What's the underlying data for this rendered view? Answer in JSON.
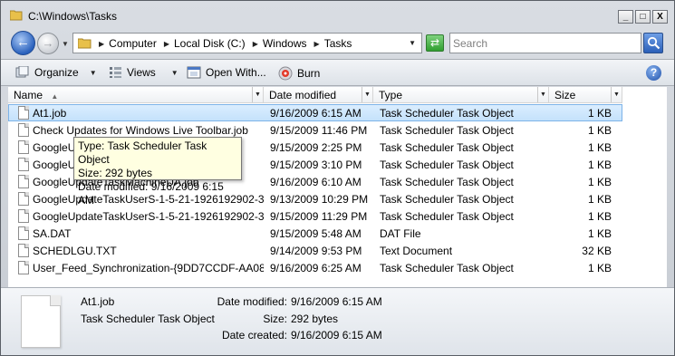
{
  "window": {
    "title": "C:\\Windows\\Tasks",
    "minimize": "_",
    "maximize": "□",
    "close": "X"
  },
  "address": {
    "crumbs": [
      "Computer",
      "Local Disk (C:)",
      "Windows",
      "Tasks"
    ],
    "search_placeholder": "Search"
  },
  "toolbar": {
    "organize": "Organize",
    "views": "Views",
    "open_with": "Open With...",
    "burn": "Burn",
    "help": "?"
  },
  "columns": {
    "name": "Name",
    "date": "Date modified",
    "type": "Type",
    "size": "Size"
  },
  "files": [
    {
      "name": "At1.job",
      "date": "9/16/2009 6:15 AM",
      "type": "Task Scheduler Task Object",
      "size": "1 KB"
    },
    {
      "name": "Check Updates for Windows Live Toolbar.job",
      "date": "9/15/2009 11:46 PM",
      "type": "Task Scheduler Task Object",
      "size": "1 KB"
    },
    {
      "name": "GoogleUpdateTaskMachineCore.job",
      "date": "9/15/2009 2:25 PM",
      "type": "Task Scheduler Task Object",
      "size": "1 KB"
    },
    {
      "name": "GoogleUpdateTaskMachineUA.job",
      "date": "9/15/2009 3:10 PM",
      "type": "Task Scheduler Task Object",
      "size": "1 KB"
    },
    {
      "name": "GoogleUpdateTaskMachineUA.job",
      "date": "9/16/2009 6:10 AM",
      "type": "Task Scheduler Task Object",
      "size": "1 KB"
    },
    {
      "name": "GoogleUpdateTaskUserS-1-5-21-1926192902-3...",
      "date": "9/13/2009 10:29 PM",
      "type": "Task Scheduler Task Object",
      "size": "1 KB"
    },
    {
      "name": "GoogleUpdateTaskUserS-1-5-21-1926192902-3...",
      "date": "9/15/2009 11:29 PM",
      "type": "Task Scheduler Task Object",
      "size": "1 KB"
    },
    {
      "name": "SA.DAT",
      "date": "9/15/2009 5:48 AM",
      "type": "DAT File",
      "size": "1 KB"
    },
    {
      "name": "SCHEDLGU.TXT",
      "date": "9/14/2009 9:53 PM",
      "type": "Text Document",
      "size": "32 KB"
    },
    {
      "name": "User_Feed_Synchronization-{9DD7CCDF-AA08...",
      "date": "9/16/2009 6:25 AM",
      "type": "Task Scheduler Task Object",
      "size": "1 KB"
    }
  ],
  "tooltip": {
    "type": "Type: Task Scheduler Task Object",
    "size": "Size: 292 bytes",
    "date": "Date modified: 9/16/2009 6:15 AM"
  },
  "details": {
    "name": "At1.job",
    "type": "Task Scheduler Task Object",
    "date_modified_label": "Date modified:",
    "date_modified": "9/16/2009 6:15 AM",
    "size_label": "Size:",
    "size": "292 bytes",
    "date_created_label": "Date created:",
    "date_created": "9/16/2009 6:15 AM"
  }
}
